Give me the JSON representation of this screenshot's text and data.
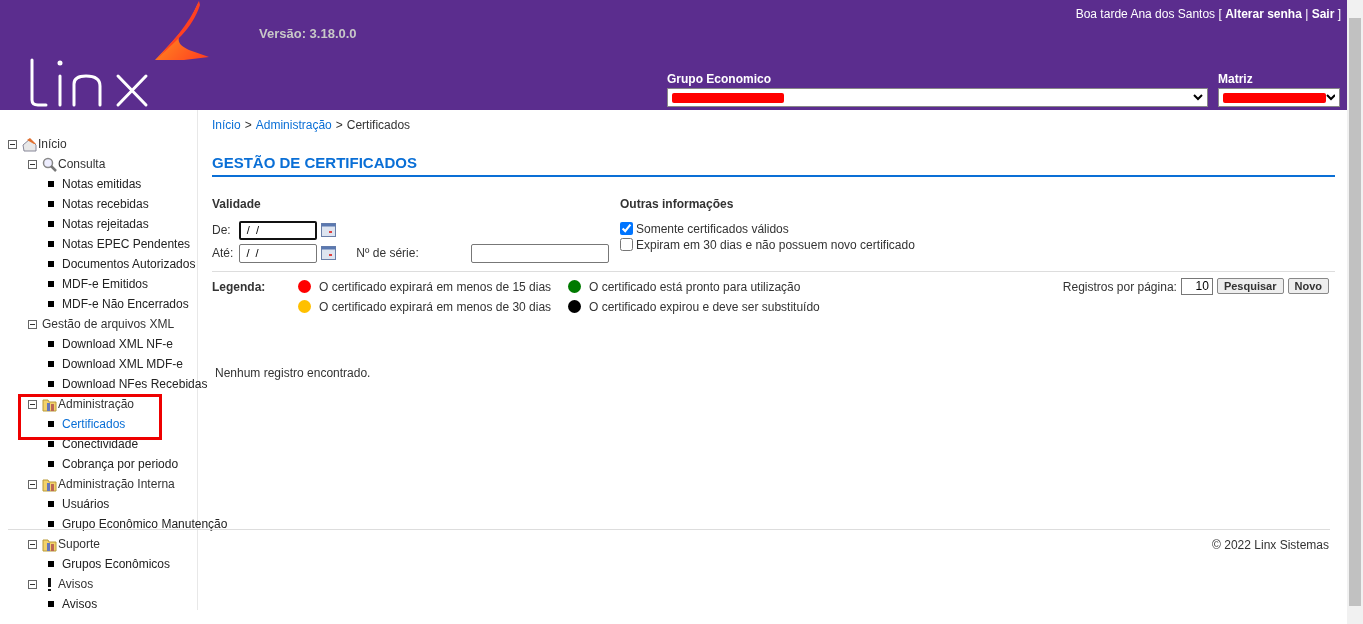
{
  "header": {
    "version": "Versão: 3.18.0.0",
    "greeting": "Boa tarde Ana dos Santos",
    "open_bracket": "[",
    "links": [
      "Alterar senha",
      "Sair"
    ],
    "separator": "|",
    "close_bracket": "]",
    "selects": [
      {
        "label": "Grupo Economico",
        "redacted": true
      },
      {
        "label": "Matriz",
        "redacted": true
      }
    ]
  },
  "sidebar": {
    "items": [
      {
        "label": "Início",
        "kind": "home",
        "expanded": true,
        "children": [
          {
            "label": "Consulta",
            "kind": "search",
            "expanded": true,
            "children": [
              {
                "label": "Notas emitidas",
                "selected": false
              },
              {
                "label": "Notas recebidas",
                "selected": false
              },
              {
                "label": "Notas rejeitadas",
                "selected": false
              },
              {
                "label": "Notas EPEC Pendentes",
                "selected": false
              },
              {
                "label": "Documentos Autorizados",
                "selected": false
              },
              {
                "label": "MDF-e Emitidos",
                "selected": false
              },
              {
                "label": "MDF-e Não Encerrados",
                "selected": false
              }
            ]
          },
          {
            "label": "Gestão de arquivos XML",
            "kind": "plain",
            "expanded": true,
            "children": [
              {
                "label": "Download XML NF-e",
                "selected": false
              },
              {
                "label": "Download XML MDF-e",
                "selected": false
              },
              {
                "label": "Download NFes Recebidas",
                "selected": false
              }
            ]
          },
          {
            "label": "Administração",
            "kind": "folder",
            "expanded": true,
            "highlighted": true,
            "children": [
              {
                "label": "Certificados",
                "selected": true
              },
              {
                "label": "Conectividade",
                "selected": false
              },
              {
                "label": "Cobrança por periodo",
                "selected": false
              }
            ]
          },
          {
            "label": "Administração Interna",
            "kind": "folder",
            "expanded": true,
            "children": [
              {
                "label": "Usuários",
                "selected": false
              },
              {
                "label": "Grupo Econômico Manutenção",
                "selected": false
              }
            ]
          },
          {
            "label": "Suporte",
            "kind": "folder",
            "expanded": true,
            "children": [
              {
                "label": "Grupos Econômicos",
                "selected": false
              }
            ]
          },
          {
            "label": "Avisos",
            "kind": "notice",
            "expanded": true,
            "children": [
              {
                "label": "Avisos",
                "selected": false
              }
            ]
          }
        ]
      }
    ]
  },
  "breadcrumb": [
    {
      "label": "Início",
      "link": true
    },
    {
      "label": "Administração",
      "link": true
    },
    {
      "label": "Certificados",
      "link": false
    }
  ],
  "breadcrumb_separator": ">",
  "title": "GESTÃO DE CERTIFICADOS",
  "validity": {
    "heading": "Validade",
    "from_label": "De:",
    "from_value": " /  /",
    "to_label": "Até:",
    "to_value": " /  /",
    "serial_label": "Nº de série:"
  },
  "other_info": {
    "heading": "Outras informações",
    "options": [
      {
        "label": "Somente certificados válidos",
        "checked": true
      },
      {
        "label": "Expiram em 30 dias e não possuem novo certificado",
        "checked": false
      }
    ]
  },
  "legend": {
    "label": "Legenda:",
    "items": [
      {
        "text": "O certificado expirará em menos de 15 dias",
        "color": "#ff0000"
      },
      {
        "text": "O certificado expirará em menos de 30 dias",
        "color": "#ffc000"
      },
      {
        "text": "O certificado está pronto para utilização",
        "color": "#007a00"
      },
      {
        "text": "O certificado expirou e deve ser substituído",
        "color": "#000000"
      }
    ]
  },
  "paging": {
    "label": "Registros por página:",
    "value": "10",
    "buttons": [
      "Pesquisar",
      "Novo"
    ]
  },
  "empty_message": "Nenhum registro encontrado.",
  "footer": "© 2022 Linx Sistemas"
}
